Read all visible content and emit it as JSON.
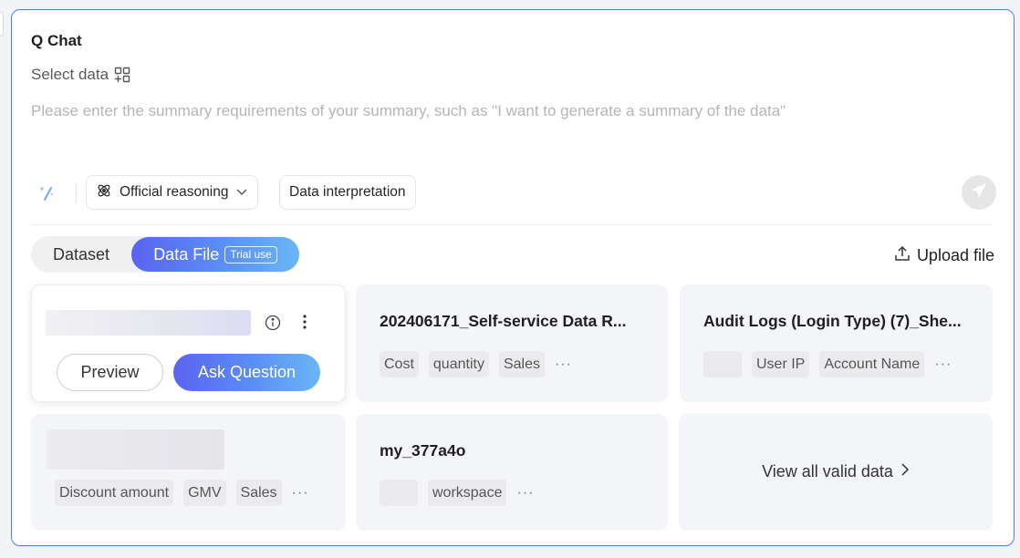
{
  "panel": {
    "title": "Q Chat",
    "select_data_label": "Select data",
    "prompt_placeholder": "Please enter the summary requirements of your summary, such as \"I want to generate a summary of the data\""
  },
  "toolbar": {
    "reasoning_label": "Official reasoning",
    "interpretation_label": "Data interpretation",
    "icons": [
      "magic-wand-icon",
      "atom-icon",
      "chevron-down-icon",
      "send-icon"
    ]
  },
  "tabs": {
    "dataset_label": "Dataset",
    "datafile_label": "Data File",
    "trial_badge": "Trial use"
  },
  "upload_label": "Upload file",
  "cards": [
    {
      "title": "",
      "preview_label": "Preview",
      "ask_label": "Ask Question"
    },
    {
      "title": "202406171_Self-service Data R...",
      "tags": [
        "Cost",
        "quantity",
        "Sales"
      ],
      "more": "···"
    },
    {
      "title": "Audit Logs (Login Type) (7)_She...",
      "tags": [
        "User IP",
        "Account Name"
      ],
      "more": "···"
    },
    {
      "title": "",
      "tags": [
        "Discount amount",
        "GMV",
        "Sales"
      ],
      "more": "···"
    },
    {
      "title": "my_377a4o",
      "tags": [
        "workspace"
      ],
      "more": "···"
    }
  ],
  "view_all_label": "View all valid data",
  "colors": {
    "accent_border": "#4f7cff",
    "gradient_start": "#5a63f0",
    "gradient_end": "#6ab6f7",
    "card_bg": "#f4f5f9",
    "placeholder_text": "#b5b5b5"
  }
}
